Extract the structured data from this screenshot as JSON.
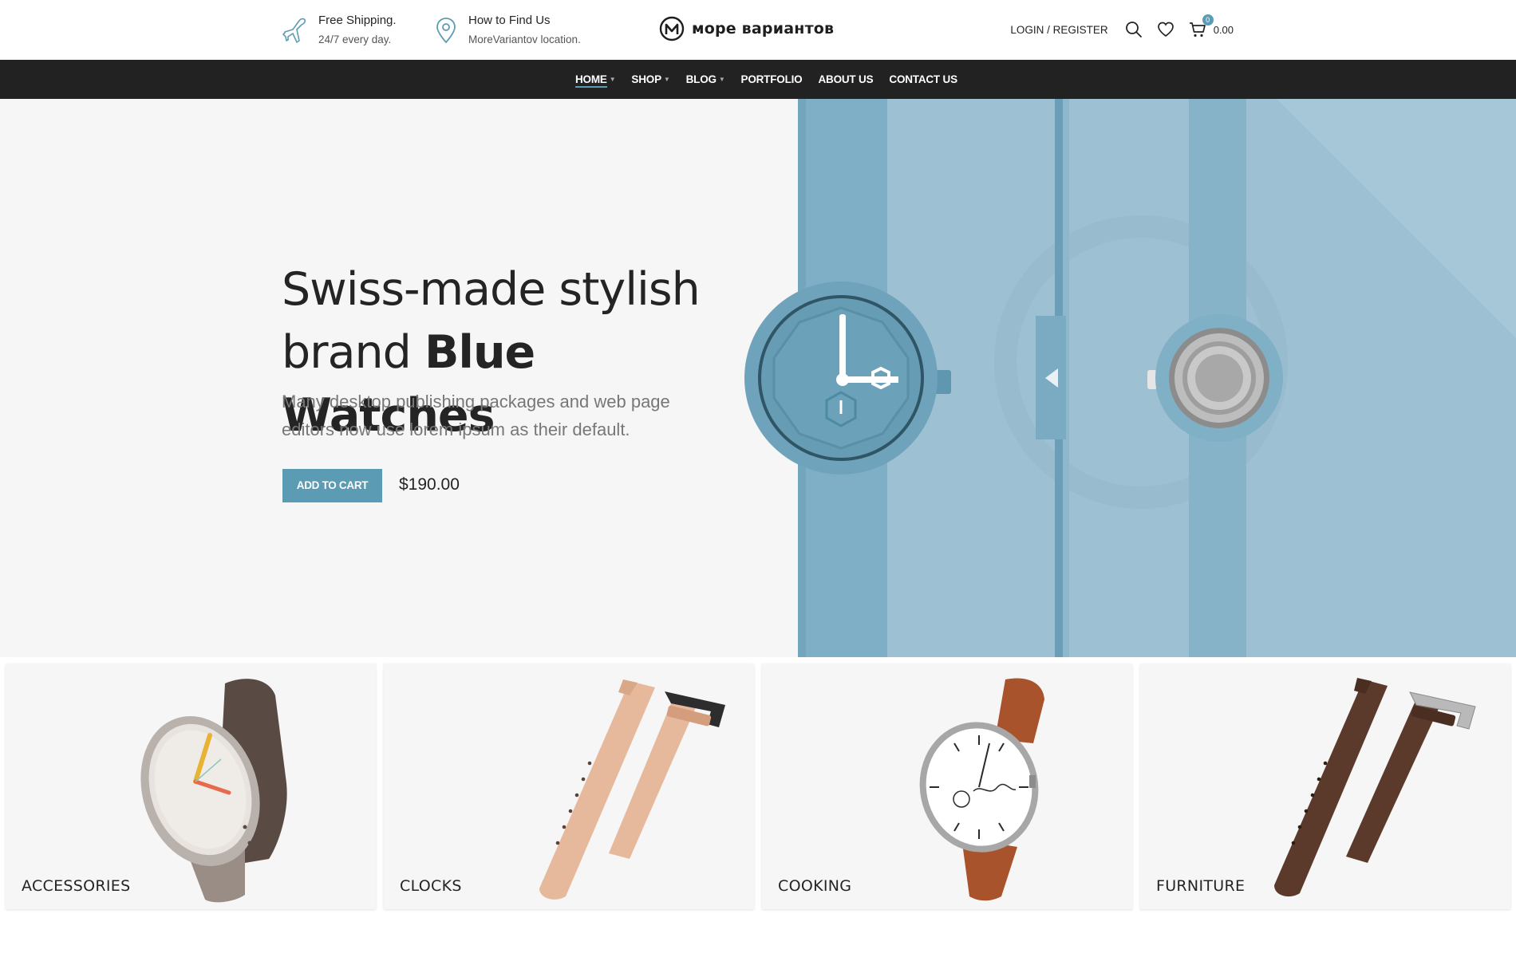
{
  "header": {
    "shipping": {
      "title": "Free Shipping.",
      "subtitle": "24/7 every day."
    },
    "location": {
      "title": "How to Find Us",
      "subtitle": "MoreVariantov location."
    },
    "logo_text": "море вариантов",
    "login_label": "LOGIN / REGISTER",
    "cart_count": "0",
    "cart_total": "0.00",
    "icons": [
      "plane-icon",
      "map-pin-icon",
      "search-icon",
      "heart-icon",
      "cart-icon"
    ]
  },
  "nav": {
    "items": [
      {
        "label": "HOME",
        "dropdown": true,
        "active": true
      },
      {
        "label": "SHOP",
        "dropdown": true
      },
      {
        "label": "BLOG",
        "dropdown": true
      },
      {
        "label": "PORTFOLIO",
        "dropdown": false
      },
      {
        "label": "ABOUT US",
        "dropdown": false
      },
      {
        "label": "CONTACT US",
        "dropdown": false
      }
    ]
  },
  "hero": {
    "title_line1": "Swiss-made stylish",
    "title_line2_regular": "brand ",
    "title_line2_bold": "Blue Watches",
    "subtitle": "Many desktop publishing packages and web page editors now use lorem ipsum as their default.",
    "button_label": "ADD TO CART",
    "price": "$190.00"
  },
  "categories": [
    {
      "label": "ACCESSORIES",
      "image": "gray-watch-image"
    },
    {
      "label": "CLOCKS",
      "image": "beige-strap-image"
    },
    {
      "label": "COOKING",
      "image": "brown-leather-watch-image"
    },
    {
      "label": "FURNITURE",
      "image": "dark-brown-strap-image"
    }
  ],
  "colors": {
    "accent": "#5b9cb4",
    "nav_bg": "#222222",
    "hero_bg": "#f6f6f6",
    "hero_blue": "#9dc0d3",
    "text": "#242424"
  }
}
